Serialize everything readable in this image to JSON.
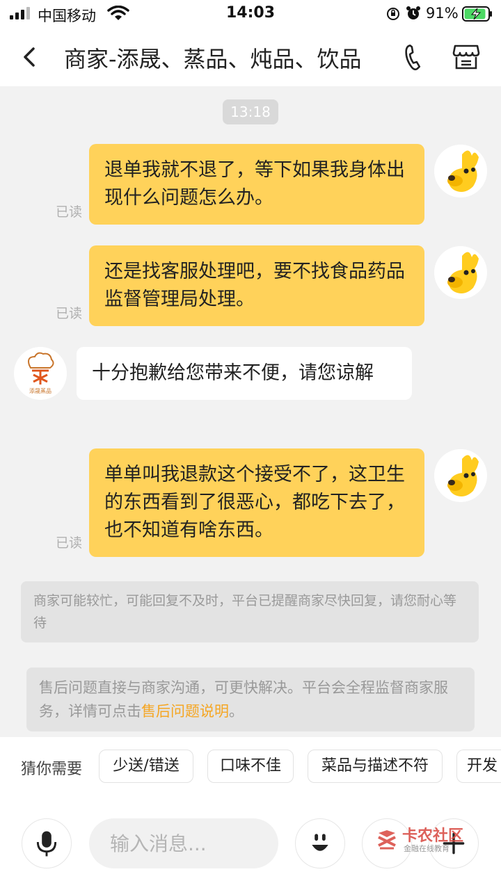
{
  "status_bar": {
    "carrier": "中国移动",
    "time": "14:03",
    "battery_percent": "91%",
    "battery_level": 0.91
  },
  "header": {
    "title": "商家-添晟、蒸品、炖品、饮品",
    "back_icon": "chevron-left-icon",
    "phone_icon": "phone-icon",
    "store_icon": "store-icon"
  },
  "chat": {
    "time_divider": "13:18",
    "messages": [
      {
        "side": "me",
        "text": "退单我就不退了，等下如果我身体出现什么问题怎么办。",
        "status": "已读"
      },
      {
        "side": "me",
        "text": "还是找客服处理吧，要不找食品药品监督管理局处理。",
        "status": "已读"
      },
      {
        "side": "them",
        "text": "十分抱歉给您带来不便，请您谅解",
        "logo_text": "添晟蒸品"
      },
      {
        "side": "me",
        "text": "单单叫我退款这个接受不了，这卫生的东西看到了很恶心，都吃下去了，也不知道有啥东西。",
        "status": "已读"
      }
    ],
    "notice_busy": "商家可能较忙，可能回复不及时，平台已提醒商家尽快回复，请您耐心等待",
    "notice_aftersale_prefix": "售后问题直接与商家沟通，可更快解决。平台会全程监督商家服务，详情可点击",
    "notice_aftersale_link": "售后问题说明",
    "notice_aftersale_suffix": "。"
  },
  "suggestions": {
    "label": "猜你需要",
    "chips": [
      "少送/错送",
      "口味不佳",
      "菜品与描述不符",
      "开发"
    ]
  },
  "input_bar": {
    "placeholder": "输入消息...",
    "mic_icon": "microphone-icon",
    "emoji_icon": "smiley-icon",
    "plus_icon": "plus-icon"
  },
  "watermark": {
    "title": "卡农社区",
    "subtitle": "金融在线教育"
  },
  "colors": {
    "my_bubble": "#ffd25a",
    "their_bubble": "#ffffff",
    "background": "#f2f2f2",
    "link": "#f5a623"
  }
}
